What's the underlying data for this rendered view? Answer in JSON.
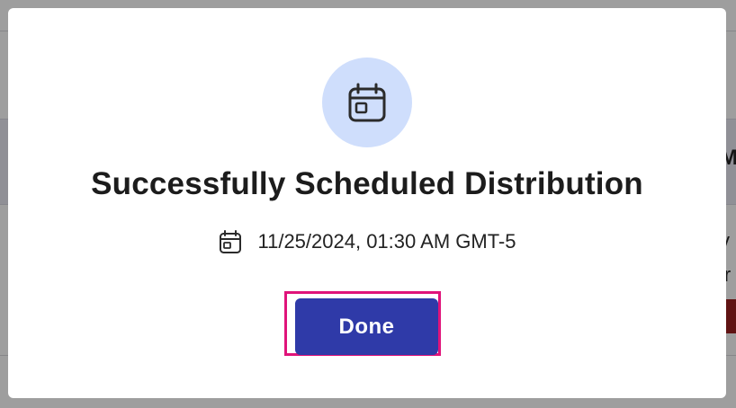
{
  "background": {
    "text_1": "M",
    "text_2": "v",
    "text_3": "ir"
  },
  "modal": {
    "icon": "calendar-icon",
    "title": "Successfully Scheduled Distribution",
    "datetime_icon": "calendar-icon",
    "datetime": "11/25/2024, 01:30 AM GMT-5",
    "done_label": "Done"
  },
  "colors": {
    "icon_circle_bg": "#cfdefc",
    "button_bg": "#2f3aa8",
    "highlight_outline": "#e0137a",
    "background_red_accent": "#9b2020"
  }
}
